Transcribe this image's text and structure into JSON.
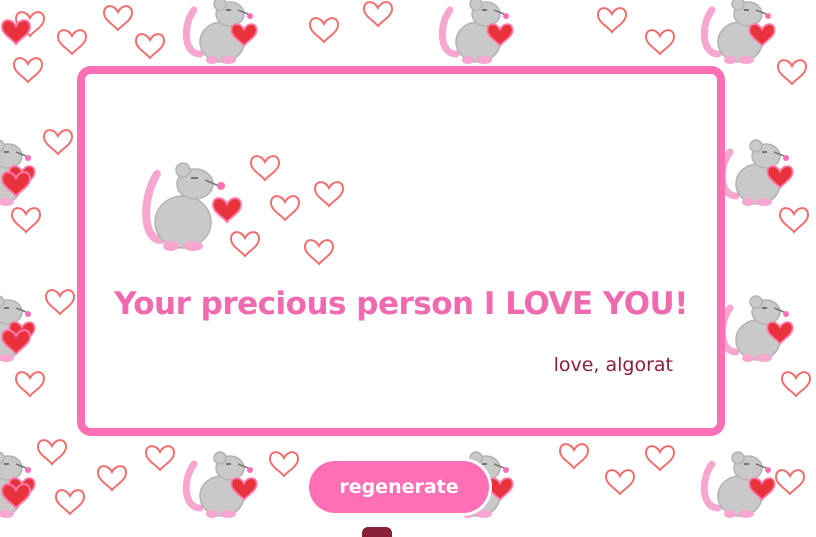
{
  "card": {
    "message": "Your precious person I LOVE YOU!",
    "signature": "love, algorat"
  },
  "controls": {
    "regenerate_label": "regenerate"
  },
  "icons": {
    "background": "rat-holding-heart-pattern",
    "card_art": "rat-with-hearts"
  },
  "colors": {
    "accent": "#ff6fb5",
    "message": "#f06ab0",
    "signature": "#8a1f3a",
    "heart_fill": "#e8323c",
    "heart_outline": "#f07070"
  }
}
